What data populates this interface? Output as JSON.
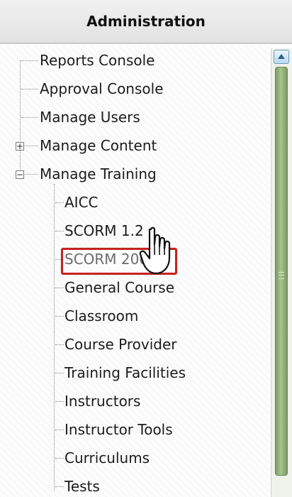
{
  "panel": {
    "title": "Administration"
  },
  "tree": {
    "items": [
      "Reports Console",
      "Approval Console",
      "Manage Users",
      "Manage Content",
      "Manage Training",
      "AICC",
      "SCORM 1.2",
      "SCORM 2004",
      "General Course",
      "Classroom",
      "Course Provider",
      "Training Facilities",
      "Instructors",
      "Instructor Tools",
      "Curriculums",
      "Tests"
    ],
    "selected": "SCORM 1.2"
  },
  "icons": {
    "collapse": "minus-icon",
    "expand": "plus-icon",
    "cursor": "hand-cursor-icon",
    "scroll_up": "chevron-up-icon"
  },
  "colors": {
    "selection": "#c52222",
    "scroll": "#8faf74"
  }
}
